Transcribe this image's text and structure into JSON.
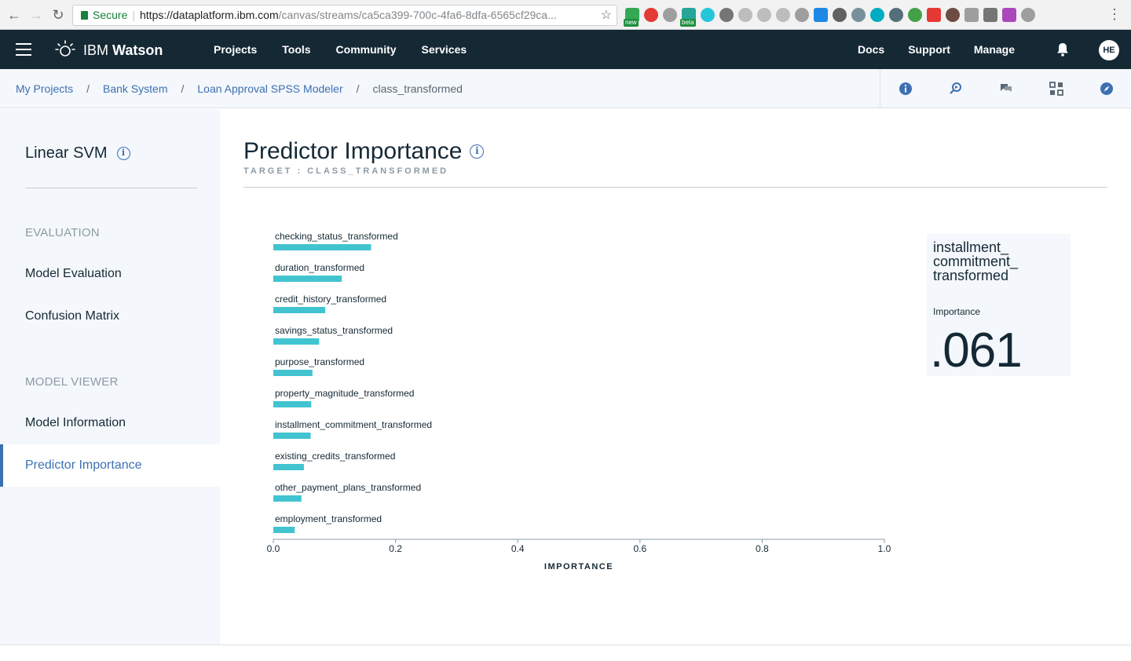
{
  "browser": {
    "secure_label": "Secure",
    "url_host": "https://dataplatform.ibm.com",
    "url_path": "/canvas/streams/ca5ca399-700c-4fa6-8dfa-6565cf29ca...",
    "ext_badges": [
      "new",
      "beta"
    ]
  },
  "header": {
    "brand_prefix": "IBM",
    "brand_name": "Watson",
    "nav_left": [
      "Projects",
      "Tools",
      "Community",
      "Services"
    ],
    "nav_right": [
      "Docs",
      "Support",
      "Manage"
    ],
    "avatar_initials": "HE"
  },
  "breadcrumb": {
    "items": [
      "My Projects",
      "Bank System",
      "Loan Approval SPSS Modeler"
    ],
    "current": "class_transformed",
    "separator": "/"
  },
  "sidebar": {
    "title": "Linear SVM",
    "sections": [
      {
        "label": "EVALUATION",
        "items": [
          "Model Evaluation",
          "Confusion Matrix"
        ]
      },
      {
        "label": "MODEL VIEWER",
        "items": [
          "Model Information",
          "Predictor Importance"
        ]
      }
    ],
    "active_item": "Predictor Importance"
  },
  "main": {
    "title": "Predictor Importance",
    "subtitle": "TARGET : CLASS_TRANSFORMED"
  },
  "detail": {
    "name": "installment_ commitment_ transformed",
    "label": "Importance",
    "value": ".061"
  },
  "colors": {
    "bar": "#41c4d0",
    "header_bg": "#152935",
    "accent": "#3d70b2"
  },
  "chart_data": {
    "type": "bar",
    "orientation": "horizontal",
    "categories": [
      "checking_status_transformed",
      "duration_transformed",
      "credit_history_transformed",
      "savings_status_transformed",
      "purpose_transformed",
      "property_magnitude_transformed",
      "installment_commitment_transformed",
      "existing_credits_transformed",
      "other_payment_plans_transformed",
      "employment_transformed"
    ],
    "values": [
      0.16,
      0.112,
      0.085,
      0.075,
      0.064,
      0.062,
      0.061,
      0.05,
      0.046,
      0.035
    ],
    "xlabel": "IMPORTANCE",
    "xlim": [
      0,
      1
    ],
    "xticks": [
      "0.0",
      "0.2",
      "0.4",
      "0.6",
      "0.8",
      "1.0"
    ],
    "grid": false
  }
}
